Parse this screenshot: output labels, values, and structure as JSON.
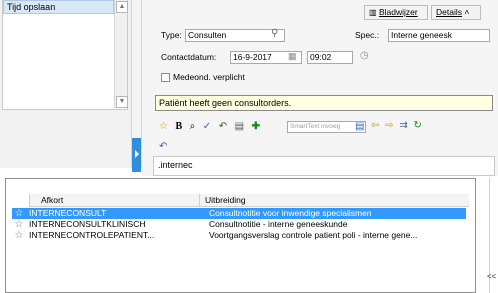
{
  "left_panel": {
    "item": "Tijd opslaan"
  },
  "top_buttons": {
    "bladwijzer": "Bladwijzer",
    "details": "Details"
  },
  "form": {
    "type_label": "Type:",
    "type_value": "Consulten",
    "spec_label": "Spec.:",
    "spec_value": "Interne geneesk",
    "date_label": "Contactdatum:",
    "date_value": "16-9-2017",
    "time_value": "09:02",
    "checkbox_label": "Medeond. verplicht",
    "warning": "Patiënt heeft geen consultorders.",
    "smarttext_placeholder": "SmartText invoeg",
    "note_text": ".internec"
  },
  "popup": {
    "headers": {
      "col1": "Afkort",
      "col2": "Uitbreiding"
    },
    "rows": [
      {
        "abbr": "INTERNECONSULT",
        "expansion": "Consultnotitie voor inwendige specialismen"
      },
      {
        "abbr": "INTERNECONSULTKLINISCH",
        "expansion": "Consultnotitie - interne geneeskunde"
      },
      {
        "abbr": "INTERNECONTROLEPATIENT...",
        "expansion": "Voortgangsverslag controle patient poli - interne gene..."
      }
    ]
  },
  "right_strip": {
    "collapse": "<<"
  },
  "colors": {
    "selection": "#3399ff",
    "warning_bg": "#ffffe1",
    "splitter_tab": "#2f8fdb"
  }
}
